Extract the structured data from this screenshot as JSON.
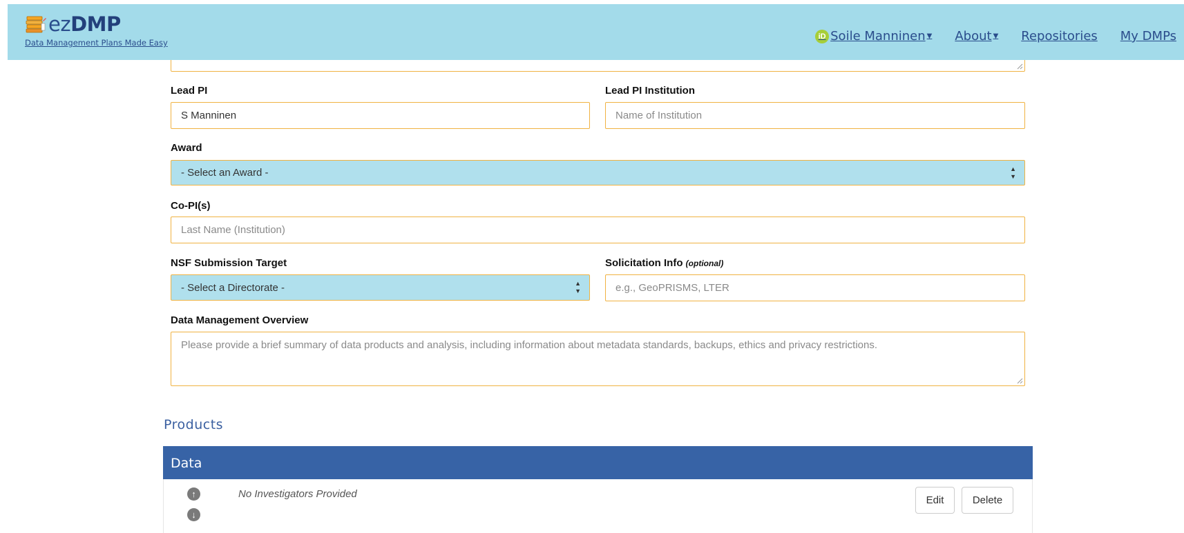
{
  "header": {
    "brand_prefix": "ez",
    "brand_name": "DMP",
    "tagline": "Data Management Plans Made Easy",
    "orcid_badge": "iD",
    "nav": [
      {
        "label": "Soile Manninen",
        "has_caret": true
      },
      {
        "label": "About",
        "has_caret": true
      },
      {
        "label": "Repositories",
        "has_caret": false
      },
      {
        "label": "My DMPs",
        "has_caret": false
      }
    ]
  },
  "form": {
    "lead_pi": {
      "label": "Lead PI",
      "value": "S Manninen"
    },
    "lead_pi_institution": {
      "label": "Lead PI Institution",
      "placeholder": "Name of Institution"
    },
    "award": {
      "label": "Award",
      "selected": "- Select an Award -"
    },
    "co_pis": {
      "label": "Co-PI(s)",
      "placeholder": "Last Name (Institution)"
    },
    "nsf_target": {
      "label": "NSF Submission Target",
      "selected": "- Select a Directorate -"
    },
    "solicitation": {
      "label": "Solicitation Info",
      "label_note": "(optional)",
      "placeholder": "e.g., GeoPRISMS, LTER"
    },
    "overview": {
      "label": "Data Management Overview",
      "placeholder": "Please provide a brief summary of data products and analysis, including information about metadata standards, backups, ethics and privacy restrictions."
    }
  },
  "products": {
    "title": "Products",
    "panel_title": "Data",
    "empty_text": "No Investigators Provided",
    "edit_label": "Edit",
    "delete_label": "Delete"
  },
  "colors": {
    "navbar": "#a3dbea",
    "brand": "#2a4d8c",
    "input_border": "#f0b241",
    "select_bg": "#b0e0ed",
    "panel_header": "#3763a6"
  }
}
